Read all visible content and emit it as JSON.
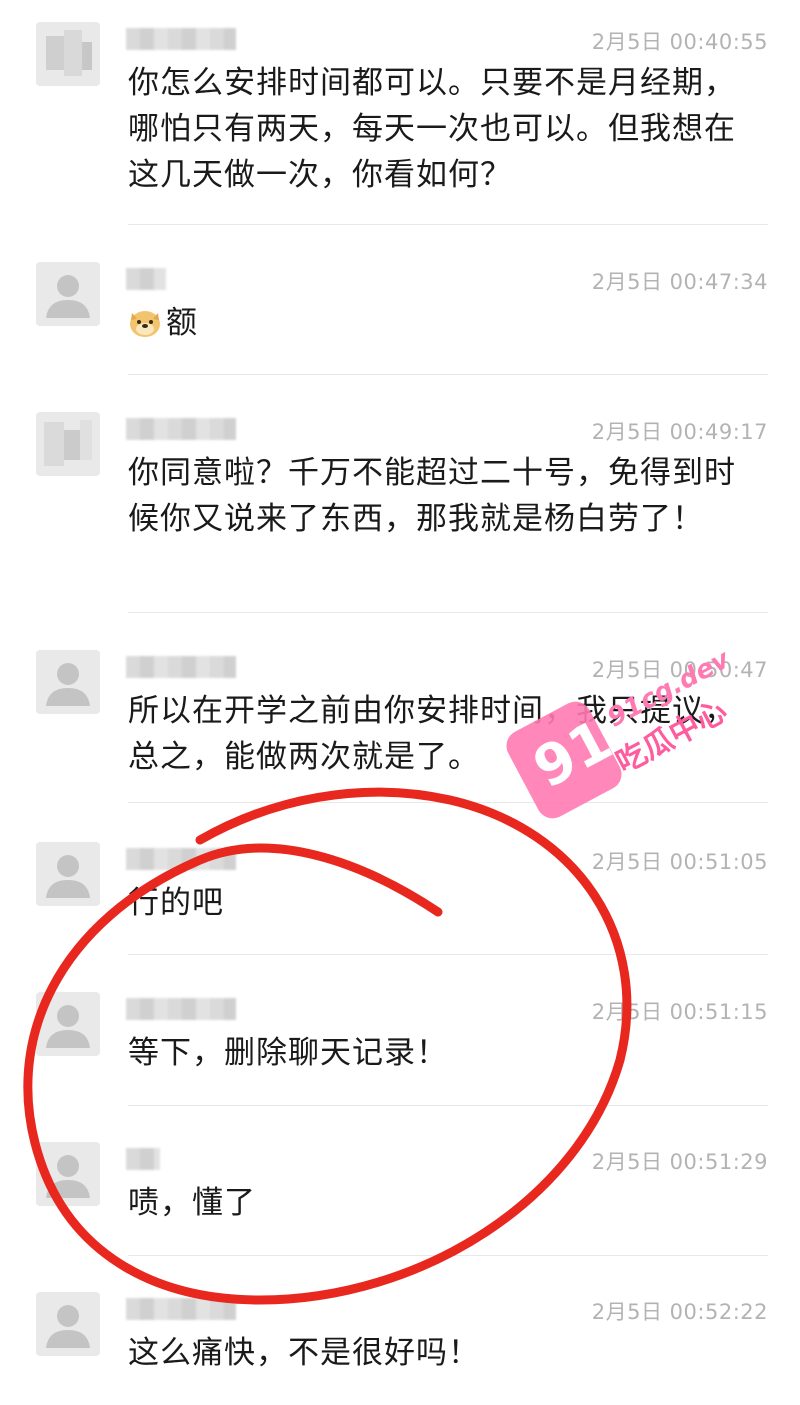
{
  "messages": [
    {
      "time": "2月5日 00:40:55",
      "text": "你怎么安排时间都可以。只要不是月经期，哪怕只有两天，每天一次也可以。但我想在这几天做一次，你看如何？"
    },
    {
      "time": "2月5日 00:47:34",
      "text": "额",
      "emoji": "doge-emoji"
    },
    {
      "time": "2月5日 00:49:17",
      "text": "你同意啦？千万不能超过二十号，免得到时候你又说来了东西，那我就是杨白劳了！"
    },
    {
      "time": "2月5日 00:50:47",
      "text": "所以在开学之前由你安排时间，我只提议，总之，能做两次就是了。"
    },
    {
      "time": "2月5日 00:51:05",
      "text": "行的吧"
    },
    {
      "time": "2月5日 00:51:15",
      "text": "等下，删除聊天记录！"
    },
    {
      "time": "2月5日 00:51:29",
      "text": "啧，懂了"
    },
    {
      "time": "2月5日 00:52:22",
      "text": "这么痛快，不是很好吗！"
    }
  ],
  "watermark": {
    "badge": "91",
    "site": "91cg.dev",
    "label": "吃瓜中心"
  },
  "colors": {
    "annotation_circle": "#e8281e",
    "watermark_pink": "#ff7ab2",
    "timestamp_gray": "#b3b3b3"
  }
}
